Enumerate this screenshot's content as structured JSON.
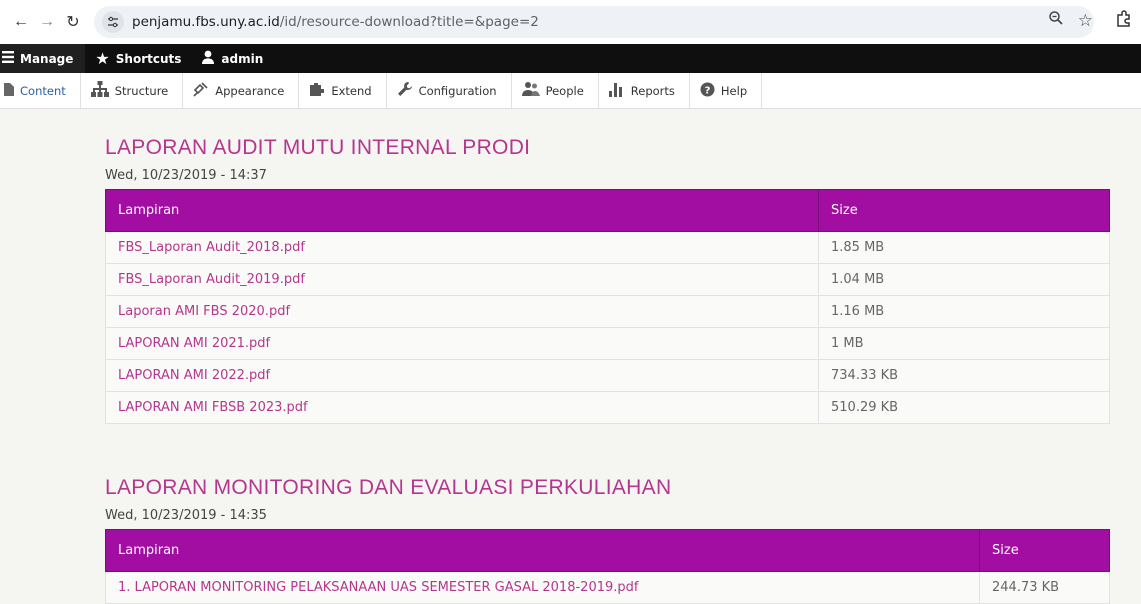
{
  "browser": {
    "url_host": "penjamu.fbs.uny.ac.id",
    "url_path": "/id/resource-download?title=&page=2"
  },
  "toolbar": {
    "manage": "Manage",
    "shortcuts": "Shortcuts",
    "user": "admin"
  },
  "tray": {
    "items": [
      "Content",
      "Structure",
      "Appearance",
      "Extend",
      "Configuration",
      "People",
      "Reports",
      "Help"
    ]
  },
  "sections": [
    {
      "title": "LAPORAN AUDIT MUTU INTERNAL PRODI",
      "date": "Wed, 10/23/2019 - 14:37",
      "col_file": "Lampiran",
      "col_size": "Size",
      "rows": [
        {
          "file": "FBS_Laporan Audit_2018.pdf",
          "size": "1.85 MB"
        },
        {
          "file": "FBS_Laporan Audit_2019.pdf",
          "size": "1.04 MB"
        },
        {
          "file": "Laporan AMI FBS 2020.pdf",
          "size": "1.16 MB"
        },
        {
          "file": "LAPORAN AMI 2021.pdf",
          "size": "1 MB"
        },
        {
          "file": "LAPORAN AMI 2022.pdf",
          "size": "734.33 KB"
        },
        {
          "file": "LAPORAN AMI FBSB 2023.pdf",
          "size": "510.29 KB"
        }
      ]
    },
    {
      "title": "LAPORAN MONITORING DAN EVALUASI PERKULIAHAN",
      "date": "Wed, 10/23/2019 - 14:35",
      "col_file": "Lampiran",
      "col_size": "Size",
      "rows": [
        {
          "file": "1. LAPORAN MONITORING PELAKSANAAN UAS SEMESTER GASAL 2018-2019.pdf",
          "size": "244.73 KB"
        }
      ]
    }
  ]
}
